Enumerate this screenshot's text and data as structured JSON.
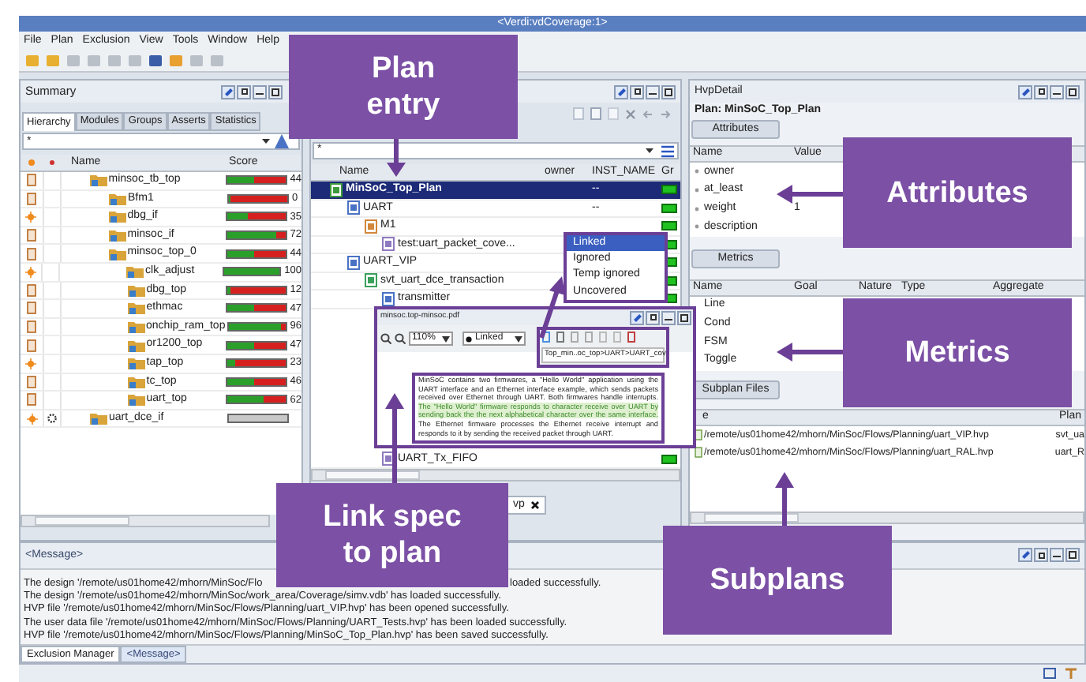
{
  "window": {
    "title": "<Verdi:vdCoverage:1>"
  },
  "menu": [
    "File",
    "Plan",
    "Exclusion",
    "View",
    "Tools",
    "Window",
    "Help"
  ],
  "summary": {
    "title": "Summary",
    "tabs": [
      {
        "label": "Hierarchy",
        "selected": true
      },
      {
        "label": "Modules",
        "selected": false
      },
      {
        "label": "Groups",
        "selected": false
      },
      {
        "label": "Asserts",
        "selected": false
      },
      {
        "label": "Statistics",
        "selected": false
      }
    ],
    "filter": "*",
    "columns": [
      "Name",
      "Score"
    ],
    "rows": [
      {
        "name": "minsoc_tb_top",
        "kind": "doc",
        "flag": false,
        "level": 0.45,
        "score": "44",
        "children": [
          {
            "name": "Bfm1",
            "kind": "doc",
            "flag": false,
            "level": 0,
            "score": "0"
          },
          {
            "name": "dbg_if",
            "kind": "star",
            "flag": false,
            "level": 0.35,
            "score": "35"
          },
          {
            "name": "minsoc_if",
            "kind": "doc",
            "flag": false,
            "level": 0.85,
            "score": "72"
          },
          {
            "name": "minsoc_top_0",
            "kind": "doc",
            "flag": false,
            "level": 0.45,
            "score": "44",
            "children": [
              {
                "name": "clk_adjust",
                "kind": "star",
                "flag": false,
                "level": 1,
                "score": "100"
              },
              {
                "name": "dbg_top",
                "kind": "doc",
                "flag": false,
                "level": 0.05,
                "score": "12"
              },
              {
                "name": "ethmac",
                "kind": "doc",
                "flag": false,
                "level": 0.47,
                "score": "47"
              },
              {
                "name": "onchip_ram_top",
                "kind": "doc",
                "flag": false,
                "level": 0.92,
                "score": "96"
              },
              {
                "name": "or1200_top",
                "kind": "doc",
                "flag": false,
                "level": 0.47,
                "score": "47"
              },
              {
                "name": "tap_top",
                "kind": "star",
                "flag": false,
                "level": 0.12,
                "score": "23"
              },
              {
                "name": "tc_top",
                "kind": "doc",
                "flag": false,
                "level": 0.46,
                "score": "46"
              },
              {
                "name": "uart_top",
                "kind": "doc",
                "flag": false,
                "level": 0.62,
                "score": "62"
              }
            ]
          }
        ]
      },
      {
        "name": "uart_dce_if",
        "kind": "star",
        "flag": true
      }
    ]
  },
  "plan": {
    "filter": "*",
    "columns": [
      "Name",
      "owner",
      "INST_NAME",
      "Gr"
    ],
    "rows": [
      {
        "name": "MinSoC_Top_Plan",
        "kind": "plan",
        "inst": "--",
        "selected": true,
        "children": [
          {
            "name": "UART",
            "kind": "feature",
            "inst": "--",
            "selected": false,
            "children": [
              {
                "name": "M1",
                "kind": "measure",
                "selected": false,
                "children": [
                  {
                    "name": "test:uart_packet_cove...",
                    "kind": "test",
                    "selected": false
                  }
                ]
              }
            ]
          },
          {
            "name": "UART_VIP",
            "kind": "feature",
            "selected": false,
            "children": [
              {
                "name": "svt_uart_dce_transaction",
                "kind": "cover",
                "selected": false,
                "children": [
                  {
                    "name": "transmitter",
                    "kind": "feature",
                    "selected": false
                  },
                  {
                    "name": "UART_Tx_FIFO",
                    "kind": "test",
                    "selected": false
                  }
                ]
              }
            ]
          }
        ]
      }
    ],
    "tabs": [
      {
        "label": "vp",
        "selected": true
      }
    ]
  },
  "link_menu": [
    {
      "label": "Linked",
      "selected": true
    },
    {
      "label": "Ignored",
      "selected": false
    },
    {
      "label": "Temp ignored",
      "selected": false
    },
    {
      "label": "Uncovered",
      "selected": false
    }
  ],
  "pdf": {
    "title": "minsoc.top-minsoc.pdf",
    "zoom": "110%",
    "filter": "Linked",
    "path": "Top_min..oc_top>UART>UART_cov",
    "text": [
      {
        "text": "MinSoC contains two firmwares, a \"Hello World\" application using the UART interface and an Ethernet interface example, which sends packets received over Ethernet through UART. Both firmwares handle interrupts. ",
        "highlighted": false
      },
      {
        "text": "The \"Hello World\" firmware responds to character receive over UART by sending back the the next alphabetical character over the same interface.",
        "highlighted": true
      },
      {
        "text": " The Ethernet firmware processes the Ethernet receive interrupt and responds to it by sending the received packet through UART.",
        "highlighted": false
      }
    ]
  },
  "detail": {
    "title": "HvpDetail",
    "plan": "Plan: MinSoC_Top_Plan",
    "attributes": {
      "button": "Attributes",
      "columns": [
        "Name",
        "Value"
      ],
      "rows": [
        {
          "name": "owner"
        },
        {
          "name": "at_least"
        },
        {
          "name": "weight",
          "value": "1"
        },
        {
          "name": "description"
        }
      ]
    },
    "metrics": {
      "button": "Metrics",
      "columns": [
        "Name",
        "Goal",
        "Nature",
        "Type",
        "Aggregate"
      ],
      "rows": [
        "Line",
        "Cond",
        "FSM",
        "Toggle"
      ]
    },
    "subplans": {
      "button": "Subplan Files",
      "columns": [
        "e",
        "Plan"
      ],
      "rows": [
        {
          "file": "/remote/us01home42/mhorn/MinSoc/Flows/Planning/uart_VIP.hvp",
          "plan": "svt_ua"
        },
        {
          "file": "/remote/us01home42/mhorn/MinSoc/Flows/Planning/uart_RAL.hvp",
          "plan": "uart_R"
        }
      ]
    }
  },
  "messages": {
    "title": "<Message>",
    "lines": [
      [
        "The design '/remote/us01home42/mhorn/MinSoc/Flo",
        "loaded successfully."
      ],
      [
        "The design '/remote/us01home42/mhorn/MinSoc/work_area/Coverage/simv.vdb' has loaded successfully."
      ],
      [
        "HVP file '/remote/us01home42/mhorn/MinSoc/Flows/Planning/uart_VIP.hvp' has been opened successfully."
      ],
      [
        "The user data file '/remote/us01home42/mhorn/MinSoc/Flows/Planning/UART_Tests.hvp' has been loaded successfully."
      ],
      [
        "HVP file '/remote/us01home42/mhorn/MinSoc/Flows/Planning/MinSoC_Top_Plan.hvp' has been saved successfully."
      ]
    ],
    "tabs": [
      {
        "label": "Exclusion Manager",
        "selected": false
      },
      {
        "label": "<Message>",
        "selected": true
      }
    ]
  },
  "callouts": [
    {
      "lines": [
        "Plan",
        "entry"
      ]
    },
    {
      "lines": [
        "Attributes"
      ]
    },
    {
      "lines": [
        "Metrics"
      ]
    },
    {
      "lines": [
        "Link spec",
        "to plan"
      ]
    },
    {
      "lines": [
        "Subplans"
      ]
    }
  ]
}
